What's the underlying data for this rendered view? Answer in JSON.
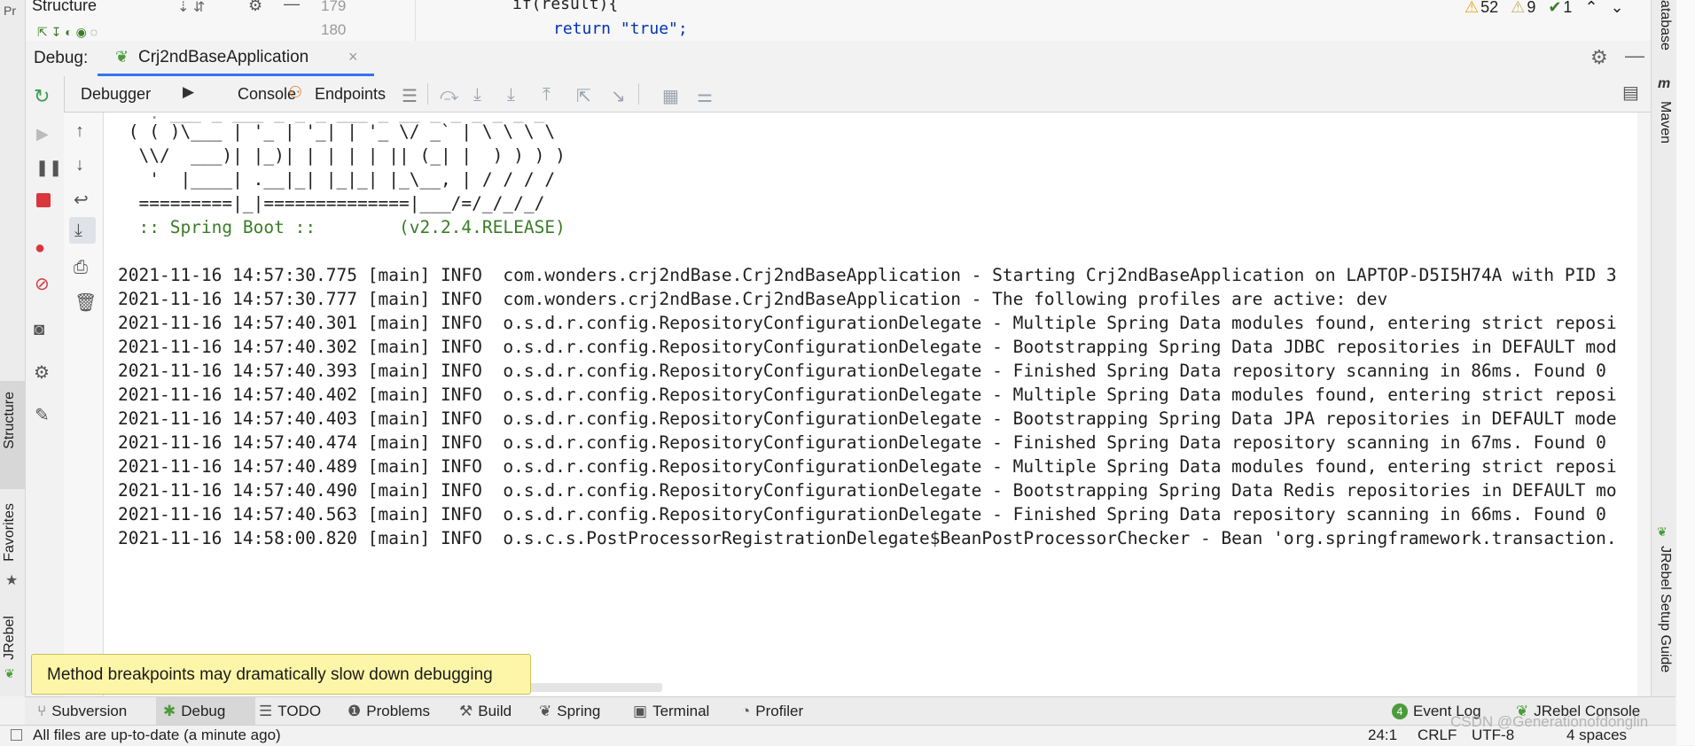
{
  "top_strip": {
    "structure_label": "Structure",
    "line_numbers": [
      "179",
      "180"
    ],
    "code_line_1": "if(result){",
    "code_line_2": "return \"true\";",
    "inspections": {
      "warnings": "52",
      "weak_warnings": "9",
      "typos": "1"
    }
  },
  "debug_header": {
    "label": "Debug:",
    "tab_title": "Crj2ndBaseApplication"
  },
  "toolbar": {
    "tabs": [
      {
        "label": "Debugger"
      },
      {
        "label": "Console"
      },
      {
        "label": "Endpoints"
      }
    ]
  },
  "console": {
    "banner": [
      " ( ( )\\___ | '_ | '_| | '_ \\/ _` | \\ \\ \\ \\",
      "  \\\\/  ___)| |_)| | | | | || (_| |  ) ) ) )",
      "   '  |____| .__|_| |_|_| |_\\__, | / / / /",
      "  =========|_|==============|___/=/_/_/_/",
      "  :: Spring Boot ::        (v2.2.4.RELEASE)"
    ],
    "log_lines": [
      "2021-11-16 14:57:30.775 [main] INFO  com.wonders.crj2ndBase.Crj2ndBaseApplication - Starting Crj2ndBaseApplication on LAPTOP-D5I5H74A with PID 3",
      "2021-11-16 14:57:30.777 [main] INFO  com.wonders.crj2ndBase.Crj2ndBaseApplication - The following profiles are active: dev",
      "2021-11-16 14:57:40.301 [main] INFO  o.s.d.r.config.RepositoryConfigurationDelegate - Multiple Spring Data modules found, entering strict reposi",
      "2021-11-16 14:57:40.302 [main] INFO  o.s.d.r.config.RepositoryConfigurationDelegate - Bootstrapping Spring Data JDBC repositories in DEFAULT mod",
      "2021-11-16 14:57:40.393 [main] INFO  o.s.d.r.config.RepositoryConfigurationDelegate - Finished Spring Data repository scanning in 86ms. Found 0",
      "2021-11-16 14:57:40.402 [main] INFO  o.s.d.r.config.RepositoryConfigurationDelegate - Multiple Spring Data modules found, entering strict reposi",
      "2021-11-16 14:57:40.403 [main] INFO  o.s.d.r.config.RepositoryConfigurationDelegate - Bootstrapping Spring Data JPA repositories in DEFAULT mode",
      "2021-11-16 14:57:40.474 [main] INFO  o.s.d.r.config.RepositoryConfigurationDelegate - Finished Spring Data repository scanning in 67ms. Found 0",
      "2021-11-16 14:57:40.489 [main] INFO  o.s.d.r.config.RepositoryConfigurationDelegate - Multiple Spring Data modules found, entering strict reposi",
      "2021-11-16 14:57:40.490 [main] INFO  o.s.d.r.config.RepositoryConfigurationDelegate - Bootstrapping Spring Data Redis repositories in DEFAULT mo",
      "2021-11-16 14:57:40.563 [main] INFO  o.s.d.r.config.RepositoryConfigurationDelegate - Finished Spring Data repository scanning in 66ms. Found 0",
      "2021-11-16 14:58:00.820 [main] INFO  o.s.c.s.PostProcessorRegistrationDelegate$BeanPostProcessorChecker - Bean 'org.springframework.transaction."
    ]
  },
  "tooltip": {
    "text": "Method breakpoints may dramatically slow down debugging"
  },
  "left_stripe": {
    "structure": "Structure",
    "favorites": "Favorites",
    "jrebel": "JRebel"
  },
  "right_stripe": {
    "database": "atabase",
    "maven": "Maven",
    "jrebel_setup": "JRebel Setup Guide"
  },
  "tool_windows": {
    "subversion": "Subversion",
    "debug": "Debug",
    "todo": "TODO",
    "problems": "Problems",
    "build": "Build",
    "spring": "Spring",
    "terminal": "Terminal",
    "profiler": "Profiler",
    "event_log_count": "4",
    "event_log": "Event Log",
    "jrebel_console": "JRebel Console"
  },
  "status_bar": {
    "message": "All files are up-to-date (a minute ago)",
    "position": "24:1",
    "line_sep": "CRLF",
    "encoding": "UTF-8",
    "indent": "4 spaces",
    "watermark": "CSDN @Generationofdonglin"
  },
  "colors": {
    "accent": "#3574f0",
    "console_green": "#3a7d27",
    "tooltip_bg": "#fdf6a8",
    "stop_red": "#d9363e"
  }
}
